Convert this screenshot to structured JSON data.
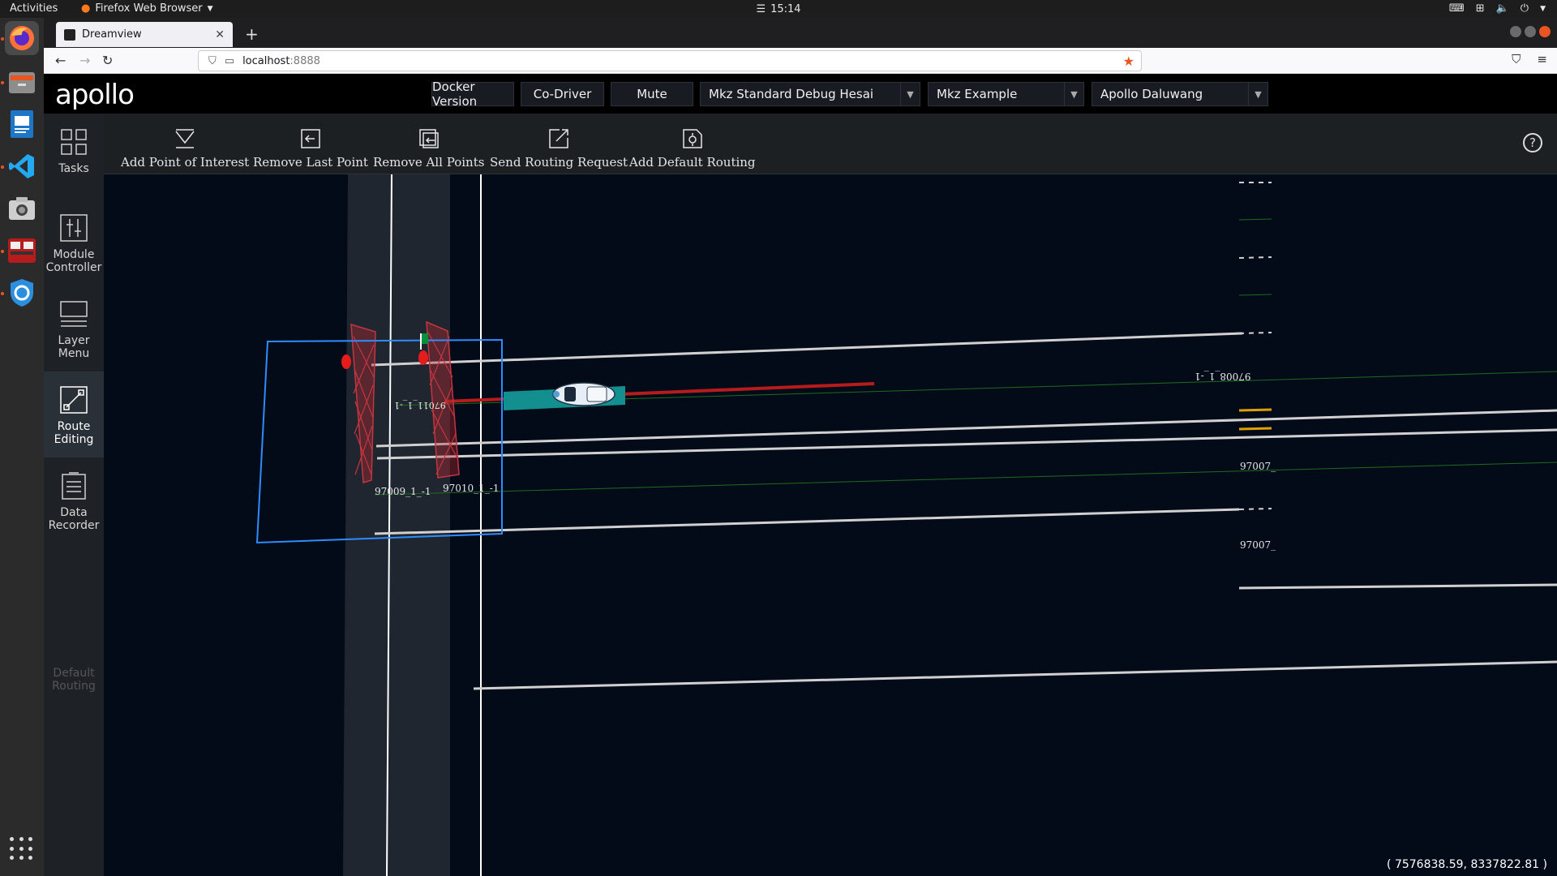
{
  "system": {
    "activities": "Activities",
    "app_menu": "Firefox Web Browser",
    "clock": "15:14"
  },
  "browser": {
    "tab_title": "Dreamview",
    "url_host": "localhost",
    "url_port": ":8888"
  },
  "header": {
    "logo": "apollo",
    "buttons": [
      "Docker Version",
      "Co-Driver",
      "Mute"
    ],
    "mode": "Mkz Standard Debug Hesai",
    "vehicle": "Mkz Example",
    "map": "Apollo Daluwang"
  },
  "side_menu": {
    "tasks": "Tasks",
    "module_controller": [
      "Module",
      "Controller"
    ],
    "layer_menu": [
      "Layer",
      "Menu"
    ],
    "route_editing": [
      "Route",
      "Editing"
    ],
    "data_recorder": [
      "Data",
      "Recorder"
    ],
    "default_routing": [
      "Default",
      "Routing"
    ]
  },
  "toolbar": {
    "add_poi": "Add Point of Interest",
    "remove_last": "Remove Last Point",
    "remove_all": "Remove All Points",
    "send_routing": "Send Routing Request",
    "add_default": "Add Default Routing"
  },
  "map": {
    "lane_labels": [
      "97011_1_-1",
      "97009_1_-1",
      "97010_1_-1",
      "97008_1_-1",
      "97007_",
      "97007_"
    ],
    "coordinates": "( 7576838.59, 8337822.81 )"
  }
}
